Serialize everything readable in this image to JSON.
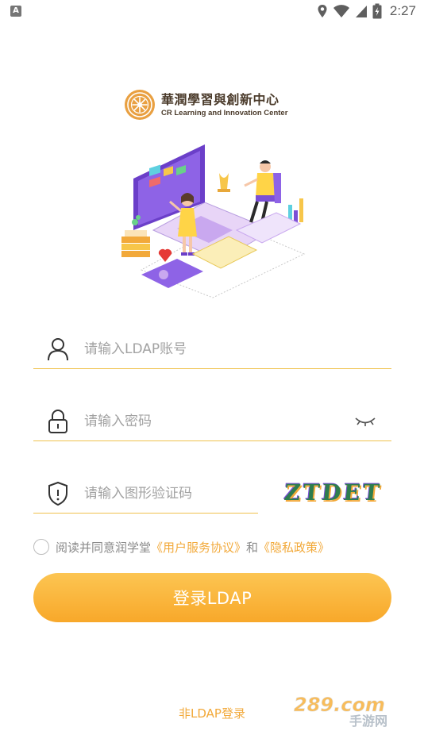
{
  "status_bar": {
    "notification_icon": "A",
    "icons": [
      "location-icon",
      "wifi-icon",
      "signal-icon",
      "battery-icon"
    ],
    "time": "2:27"
  },
  "logo": {
    "title": "華潤學習與創新中心",
    "subtitle": "CR Learning and Innovation Center"
  },
  "form": {
    "account_placeholder": "请输入LDAP账号",
    "password_placeholder": "请输入密码",
    "captcha_placeholder": "请输入图形验证码",
    "captcha_text": "ZTDET"
  },
  "agreement": {
    "prefix": "阅读并同意润学堂",
    "user_agreement": "《用户服务协议》",
    "and": "和",
    "privacy_policy": "《隐私政策》"
  },
  "login_button": "登录LDAP",
  "non_ldap_link": "非LDAP登录",
  "watermark": {
    "top": "289.com",
    "bottom": "手游网"
  },
  "colors": {
    "accent": "#f2a93a",
    "underline": "#f0c24e",
    "button_top": "#fcc552",
    "button_bottom": "#f8a82a",
    "illustration_purple": "#7b4fd6"
  }
}
